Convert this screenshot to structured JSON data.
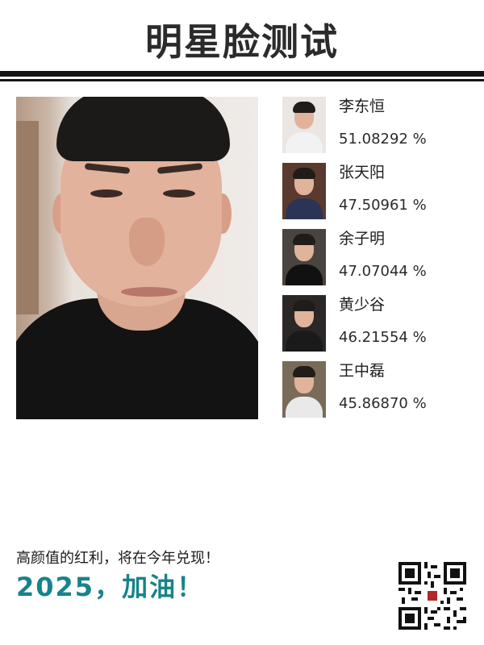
{
  "header": {
    "title": "明星脸测试"
  },
  "user_photo": {
    "icon": "user-face-photo"
  },
  "matches": [
    {
      "name": "李东恒",
      "score": "51.08292 %",
      "colors": {
        "bg": "#e9e6e4",
        "body": "#f2f2f2"
      }
    },
    {
      "name": "张天阳",
      "score": "47.50961 %",
      "colors": {
        "bg": "#5a3a2e",
        "body": "#2a3555"
      }
    },
    {
      "name": "余子明",
      "score": "47.07044 %",
      "colors": {
        "bg": "#4a4440",
        "body": "#111111"
      }
    },
    {
      "name": "黄少谷",
      "score": "46.21554 %",
      "colors": {
        "bg": "#2b2727",
        "body": "#1a1a1a"
      }
    },
    {
      "name": "王中磊",
      "score": "45.86870 %",
      "colors": {
        "bg": "#7a6a58",
        "body": "#e9e9e9"
      }
    }
  ],
  "footer": {
    "tagline": "高颜值的红利，将在今年兑现！",
    "motto": "2025，加油！",
    "motto_color": "#17838a",
    "qr_icon": "qr-code-icon"
  }
}
